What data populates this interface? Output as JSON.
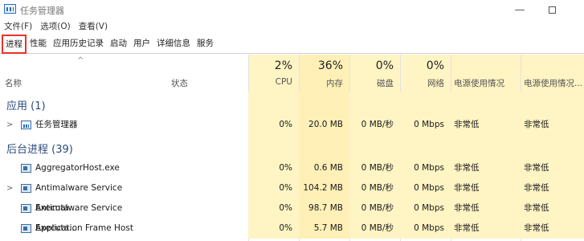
{
  "window": {
    "title": "任务管理器",
    "minimize_glyph": "—",
    "close_glyph": ""
  },
  "menu": [
    "文件(F)",
    "选项(O)",
    "查看(V)"
  ],
  "tabs": [
    "进程",
    "性能",
    "应用历史记录",
    "启动",
    "用户",
    "详细信息",
    "服务"
  ],
  "header": {
    "sort_arrow": "^",
    "name_label": "名称",
    "status_label": "状态",
    "cpu": {
      "pct": "2%",
      "label": "CPU"
    },
    "memory": {
      "pct": "36%",
      "label": "内存"
    },
    "disk": {
      "pct": "0%",
      "label": "磁盘"
    },
    "network": {
      "pct": "0%",
      "label": "网络"
    },
    "power_label": "电源使用情况",
    "power_trend_label": "电源使用情况..."
  },
  "groups": {
    "apps": "应用 (1)",
    "background": "后台进程 (39)"
  },
  "apps": [
    {
      "name": "任务管理器",
      "cpu": "0%",
      "memory": "20.0 MB",
      "disk": "0 MB/秒",
      "network": "0 Mbps",
      "power": "非常低",
      "power_trend": "非常低"
    }
  ],
  "background": [
    {
      "name": "AggregatorHost.exe",
      "cpu": "0%",
      "memory": "0.6 MB",
      "disk": "0 MB/秒",
      "network": "0 Mbps",
      "power": "非常低",
      "power_trend": "非常低"
    },
    {
      "name": "Antimalware Service Executa...",
      "cpu": "0%",
      "memory": "104.2 MB",
      "disk": "0 MB/秒",
      "network": "0 Mbps",
      "power": "非常低",
      "power_trend": "非常低"
    },
    {
      "name": "Antimalware Service Executa...",
      "cpu": "0%",
      "memory": "98.7 MB",
      "disk": "0 MB/秒",
      "network": "0 Mbps",
      "power": "非常低",
      "power_trend": "非常低"
    },
    {
      "name": "Application Frame Host",
      "cpu": "0%",
      "memory": "5.7 MB",
      "disk": "0 MB/秒",
      "network": "0 Mbps",
      "power": "非常低",
      "power_trend": "非常低"
    }
  ],
  "colors": {
    "active_tab_border": "#e8332b",
    "group_label": "#2b4a7a",
    "heat_light": "#fff4c4",
    "heat_mid": "#fff0b8"
  }
}
